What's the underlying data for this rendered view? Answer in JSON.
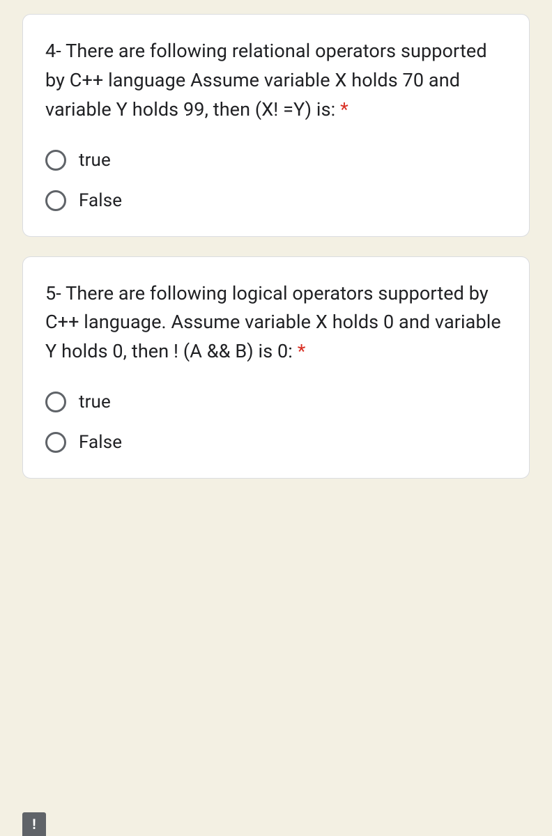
{
  "questions": [
    {
      "text": "4- There are following relational operators supported by C++ language Assume variable X holds 70 and variable Y holds 99, then (X! =Y) is: ",
      "required": "*",
      "options": [
        "true",
        "False"
      ]
    },
    {
      "text": "5- There are following logical operators supported by C++ language. Assume variable X holds 0 and variable Y holds 0, then ! (A && B) is 0: ",
      "required": "*",
      "options": [
        "true",
        "False"
      ]
    }
  ],
  "alert": "!"
}
